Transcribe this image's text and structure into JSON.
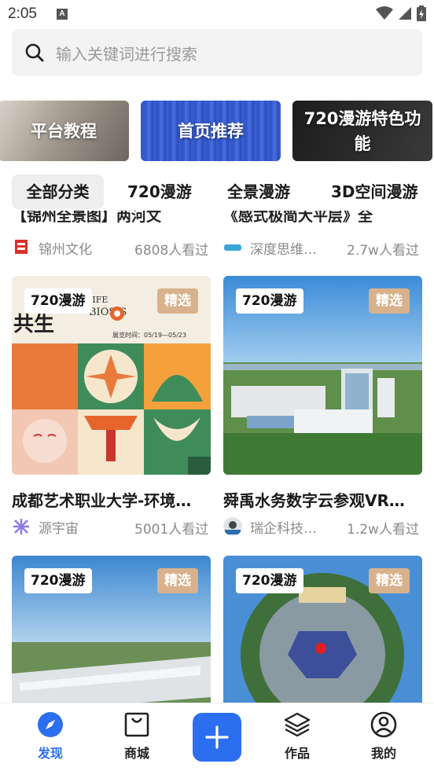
{
  "status_bar": {
    "time": "2:05",
    "notification": "A"
  },
  "search": {
    "placeholder": "输入关键词进行搜索"
  },
  "banners": [
    {
      "label": "平台教程"
    },
    {
      "label": "首页推荐"
    },
    {
      "label_line1": "720漫游特色功",
      "label_line2": "能"
    }
  ],
  "tabs": [
    "全部分类",
    "720漫游",
    "全景漫游",
    "3D空间漫游"
  ],
  "partial_row": [
    {
      "title": "【锦州全景图】两河文",
      "author": "锦州文化",
      "views": "6808人看过"
    },
    {
      "title": "《感式极简大平层》全",
      "author": "深度思维…",
      "views": "2.7w人看过"
    }
  ],
  "cards": [
    {
      "type": "720漫游",
      "pick": "精选",
      "title": "成都艺术职业大学-环境…",
      "author": "源宇宙",
      "views": "5001人看过",
      "poster_text_1": "共生",
      "poster_text_2": "展览时间：05/19—05/23",
      "poster_text_3": "BIOSIS",
      "poster_text_4": "IIFE"
    },
    {
      "type": "720漫游",
      "pick": "精选",
      "title": "舜禹水务数字云参观VR…",
      "author": "瑞企科技V…",
      "views": "1.2w人看过"
    },
    {
      "type": "720漫游",
      "pick": "精选",
      "title": "",
      "author": "",
      "views": ""
    },
    {
      "type": "720漫游",
      "pick": "精选",
      "title": "",
      "author": "",
      "views": ""
    }
  ],
  "bottom_nav": [
    {
      "label": "发现",
      "icon": "compass-icon",
      "active": true
    },
    {
      "label": "商城",
      "icon": "shopping-bag-icon",
      "active": false
    },
    {
      "label": "作品",
      "icon": "layers-icon",
      "active": false
    },
    {
      "label": "我的",
      "icon": "user-circle-icon",
      "active": false
    }
  ],
  "colors": {
    "accent": "#2b6ff0",
    "pick_badge": "#d8b28c",
    "search_bg": "#f3f3f3"
  }
}
